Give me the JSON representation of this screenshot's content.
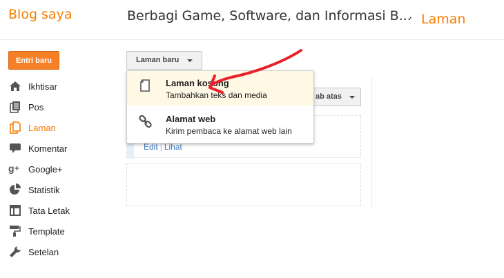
{
  "header": {
    "brand": "Blog saya",
    "blog_title": "Berbagi Game, Software, dan Informasi B...",
    "separator": "·",
    "section": "Laman"
  },
  "sidebar": {
    "new_post_label": "Entri baru",
    "items": [
      {
        "label": "Ikhtisar",
        "icon": "home-icon"
      },
      {
        "label": "Pos",
        "icon": "posts-icon"
      },
      {
        "label": "Laman",
        "icon": "pages-icon",
        "active": true
      },
      {
        "label": "Komentar",
        "icon": "comment-icon"
      },
      {
        "label": "Google+",
        "icon": "google-plus-icon"
      },
      {
        "label": "Statistik",
        "icon": "pie-chart-icon"
      },
      {
        "label": "Tata Letak",
        "icon": "layout-icon"
      },
      {
        "label": "Template",
        "icon": "paint-roller-icon"
      },
      {
        "label": "Setelan",
        "icon": "wrench-icon"
      }
    ]
  },
  "toolbar": {
    "new_page_label": "Laman baru",
    "tabs_label": "ab atas"
  },
  "menu": {
    "items": [
      {
        "title": "Laman kosong",
        "description": "Tambahkan teks dan media",
        "icon": "blank-page-icon"
      },
      {
        "title": "Alamat web",
        "description": "Kirim pembaca ke alamat web lain",
        "icon": "link-icon"
      }
    ]
  },
  "page_list": {
    "edit_label": "Edit",
    "separator": "|",
    "view_label": "Lihat"
  },
  "colors": {
    "accent": "#f57d00",
    "button_orange": "#f58026",
    "link": "#3f80c7",
    "annotation_arrow": "#e8202a"
  }
}
